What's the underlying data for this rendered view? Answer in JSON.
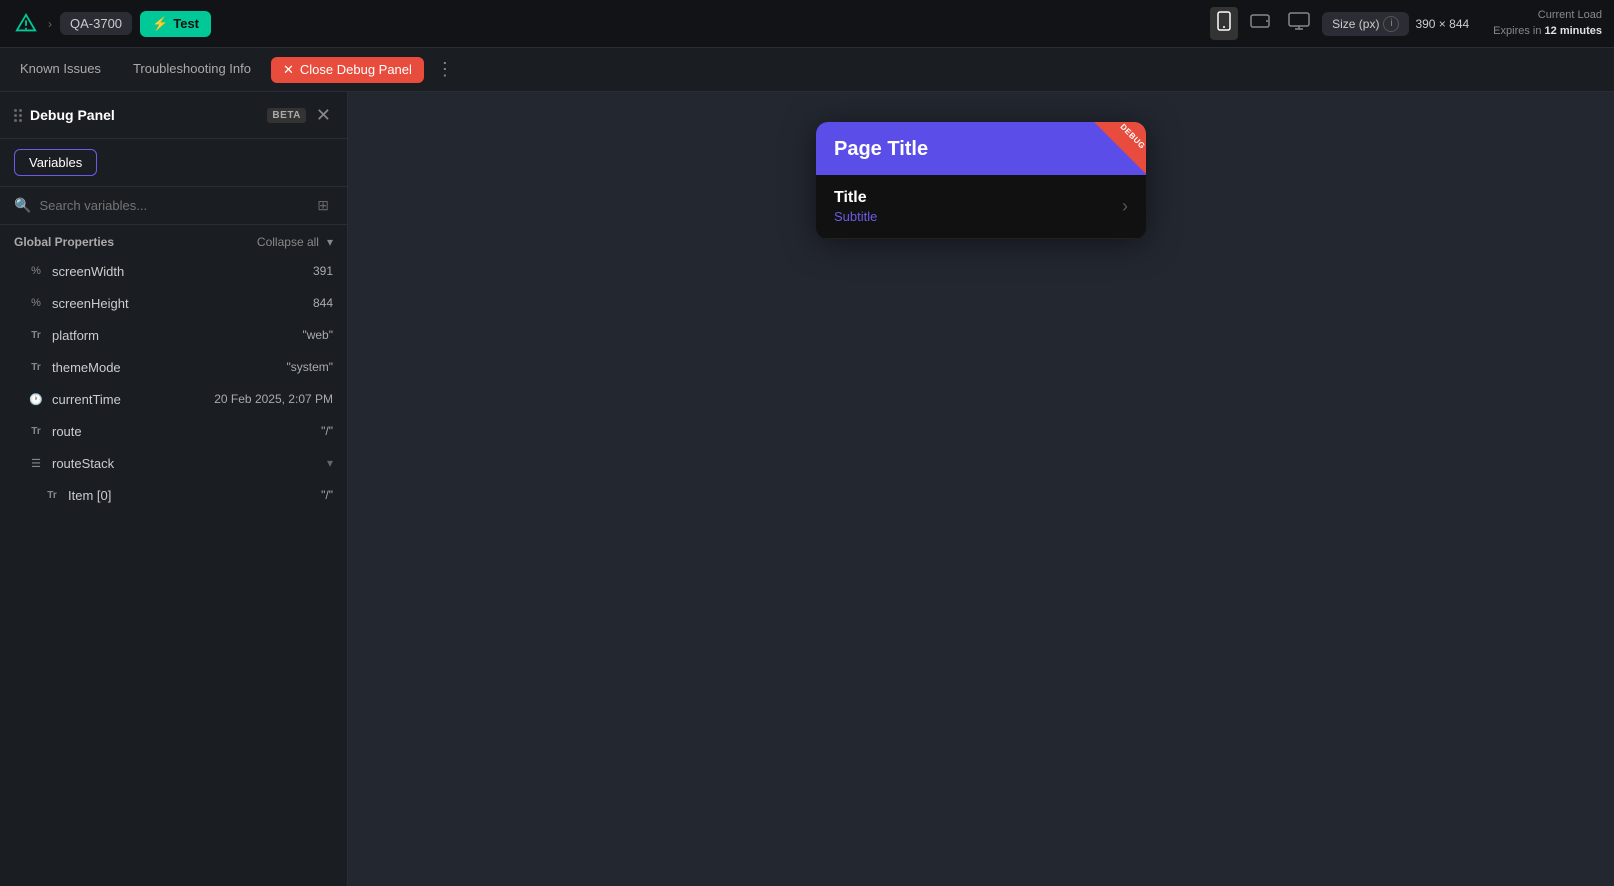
{
  "topBar": {
    "logoAlt": "App Logo",
    "breadcrumb": "QA-3700",
    "testButton": "Test",
    "chevron": "›",
    "devices": [
      {
        "id": "mobile",
        "label": "Mobile",
        "active": true
      },
      {
        "id": "tablet",
        "label": "Tablet",
        "active": false
      },
      {
        "id": "desktop",
        "label": "Desktop",
        "active": false
      }
    ],
    "sizeLabel": "Size (px)",
    "sizeValue": "390 × 844",
    "currentLoad": "Current Load",
    "expiresLabel": "Expires in",
    "expiresValue": "12 minutes"
  },
  "tabs": [
    {
      "id": "known-issues",
      "label": "Known Issues",
      "active": false
    },
    {
      "id": "troubleshooting",
      "label": "Troubleshooting Info",
      "active": false
    },
    {
      "id": "close-debug",
      "label": "Close Debug Panel",
      "isClose": true
    }
  ],
  "debugPanel": {
    "title": "Debug Panel",
    "betaBadge": "BETA",
    "tabsButtons": [
      {
        "id": "variables",
        "label": "Variables",
        "active": true
      }
    ],
    "searchPlaceholder": "Search variables...",
    "collapseAll": "Collapse all",
    "sections": [
      {
        "id": "global",
        "title": "Global Properties",
        "collapsed": false,
        "variables": [
          {
            "name": "screenWidth",
            "value": "391",
            "type": "number",
            "icon": "numeric"
          },
          {
            "name": "screenHeight",
            "value": "844",
            "type": "number",
            "icon": "numeric"
          },
          {
            "name": "platform",
            "value": "\"web\"",
            "type": "string",
            "icon": "text"
          },
          {
            "name": "themeMode",
            "value": "\"system\"",
            "type": "string",
            "icon": "text"
          },
          {
            "name": "currentTime",
            "value": "20 Feb 2025, 2:07 PM",
            "type": "date",
            "icon": "clock"
          },
          {
            "name": "route",
            "value": "\"/\"",
            "type": "string",
            "icon": "text"
          },
          {
            "name": "routeStack",
            "value": "",
            "type": "array",
            "icon": "list",
            "collapsed": false
          },
          {
            "name": "Item [0]",
            "value": "\"/\"",
            "type": "string",
            "icon": "text",
            "indent": true
          }
        ]
      }
    ]
  },
  "preview": {
    "pageTitle": "Page Title",
    "debugBadge": "DEBUG",
    "listItem": {
      "title": "Title",
      "subtitle": "Subtitle"
    }
  }
}
